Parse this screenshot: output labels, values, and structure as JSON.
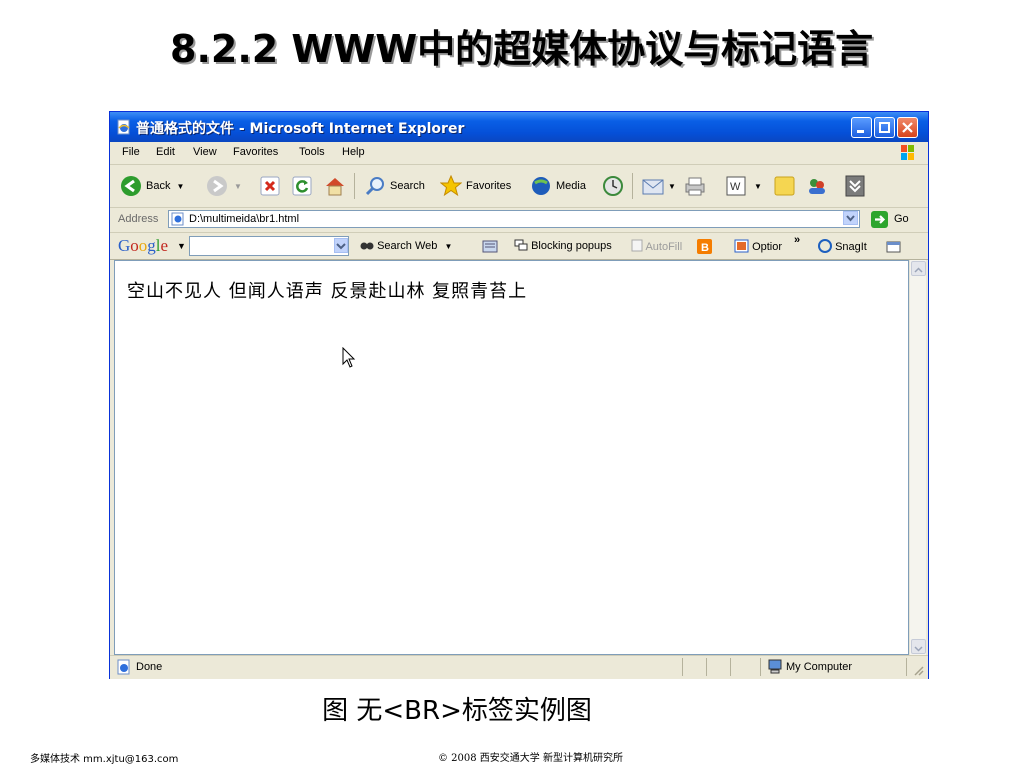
{
  "slide": {
    "title": "8.2.2 WWW中的超媒体协议与标记语言",
    "caption": "图 无<BR>标签实例图",
    "footer_left": "多媒体技术 mm.xjtu@163.com",
    "footer_center": "© 2008 西安交通大学 新型计算机研究所"
  },
  "window": {
    "title": "普通格式的文件 - Microsoft Internet Explorer",
    "icon": "ie-page-icon"
  },
  "menu": [
    "File",
    "Edit",
    "View",
    "Favorites",
    "Tools",
    "Help"
  ],
  "toolbar": {
    "back": "Back",
    "search": "Search",
    "favorites": "Favorites",
    "media": "Media"
  },
  "address": {
    "label": "Address",
    "value": "D:\\multimeida\\br1.html",
    "go": "Go"
  },
  "google_bar": {
    "logo": [
      "G",
      "o",
      "o",
      "g",
      "l",
      "e"
    ],
    "search_web": "Search Web",
    "blocking_popups": "Blocking popups",
    "autofill": "AutoFill",
    "options": "Optior",
    "snagit": "SnagIt"
  },
  "page": {
    "content": "空山不见人 但闻人语声 反景赴山林 复照青苔上"
  },
  "status": {
    "text": "Done",
    "zone": "My Computer"
  },
  "colors": {
    "titlebar": "#0550d8",
    "chrome": "#ece9d8",
    "close": "#d6431c"
  }
}
